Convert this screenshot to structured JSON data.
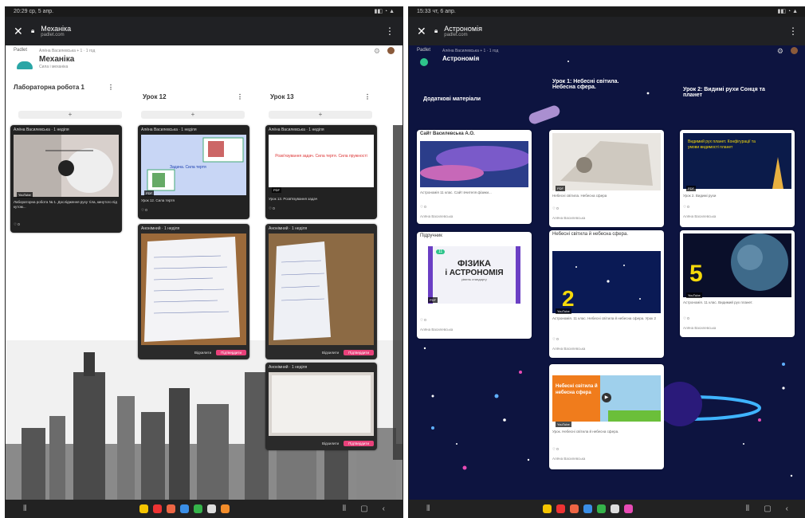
{
  "left_phone": {
    "status": {
      "time": "20:29 ср, 5 апр.",
      "icons": "▮◧ ◔ ▲"
    },
    "topbar": {
      "title": "Механіка",
      "url": "padlet.com"
    },
    "padlet_label": "Padlet",
    "author_line": "Алёна Василевська + 1 · 1 год",
    "pad_title": "Механіка",
    "pad_sub": "Сила і механіка",
    "columns": [
      {
        "title": "Лабораторна робота 1"
      },
      {
        "title": "Урок 12"
      },
      {
        "title": "Урок 13"
      }
    ],
    "cards": [
      {
        "author": "Алёна Василевська · 1 неділя",
        "tag": "YouTube",
        "text": "Лабораторна робота № 1. Дослідження руху тіла, кинутого під кутом...",
        "reactions": "♡ 0"
      },
      {
        "author": "Алёна Василевська · 1 неділя",
        "tag": "PDF",
        "image_text": "Задача. Сила тертя",
        "text": "Урок 12. Сила тертя",
        "reactions": "♡ 0"
      },
      {
        "author": "Алёна Василевська · 1 неділя",
        "tag": "PDF",
        "image_text": "Розв'язування задач. Сила тертя. Сила пружності",
        "text": "Урок 13. Розв'язування задач",
        "reactions": "♡ 0"
      },
      {
        "author": "Анонімний · 1 неділя",
        "btn_reject": "Відхилити",
        "btn_approve": "Підтвердити"
      },
      {
        "author": "Анонімний · 1 неділя",
        "btn_reject": "Відхилити",
        "btn_approve": "Підтвердити"
      },
      {
        "author": "Анонімний · 1 неділя",
        "btn_reject": "Відхилити",
        "btn_approve": "Підтвердити"
      }
    ],
    "nav": {
      "menu": "⦀",
      "home": "▢",
      "back": "‹"
    }
  },
  "right_phone": {
    "status": {
      "time": "15:33 чт, 6 апр.",
      "icons": "▮◧ ◔ ▲"
    },
    "topbar": {
      "title": "Астрономія",
      "url": "padlet.com"
    },
    "padlet_label": "Padlet",
    "author_line": "Алёна Василевська + 1 · 1 год",
    "pad_title": "Астрономія",
    "columns": [
      {
        "title": "Додаткові матеріали"
      },
      {
        "title": "Урок 1: Небесні світила. Небесна сфера."
      },
      {
        "title": "Урок 2: Видимі рухи Сонця та планет"
      }
    ],
    "cards": [
      {
        "title": "Сайт Василевська А.О.",
        "text": "Астрономія 11 клас. Сайт вчителя фізики...",
        "author": "Алёна Василевська",
        "reactions": "♡ 0"
      },
      {
        "title": "Підручник",
        "book_title_1": "ФІЗИКА",
        "book_title_2": "i АСТРОНОМІЯ",
        "book_sub": "рівень стандарту",
        "book_badge": "11",
        "tag": "PDF",
        "author": "Алёна Василевська",
        "reactions": "♡ 0"
      },
      {
        "tag": "PDF",
        "text": "Небесні світила. Небесна сфера",
        "author": "Алёна Василевська",
        "reactions": "♡ 0"
      },
      {
        "title": "Небесні світила й небесна сфера.",
        "big_num": "2",
        "tag": "YouTube",
        "text": "Астрономія. 11 клас. Небесні світила й небесна сфера. Урок 2",
        "author": "Алёна Василевська",
        "reactions": "♡ 0"
      },
      {
        "tag": "YouTube",
        "image_text": "Небесні світила й небесна сфера",
        "text": "Урок. Небесні світила й небесна сфера.",
        "author": "Алёна Василевська",
        "reactions": "♡ 0"
      },
      {
        "tag": "PDF",
        "image_text": "Видимий рух планет. Конфігурації та умови видимості планет",
        "text": "Урок 2. Видимі рухи",
        "author": "Алёна Василевська",
        "reactions": "♡ 0"
      },
      {
        "big_num": "5",
        "tag": "YouTube",
        "text": "Астрономія. 11 клас. Видимий рух планет.",
        "author": "Алёна Василевська",
        "reactions": "♡ 0"
      }
    ],
    "nav": {
      "menu": "⦀",
      "home": "▢",
      "back": "‹"
    }
  },
  "colors": {
    "pink": "#e8417a",
    "space": "#0d1440",
    "topbar": "#202124"
  }
}
